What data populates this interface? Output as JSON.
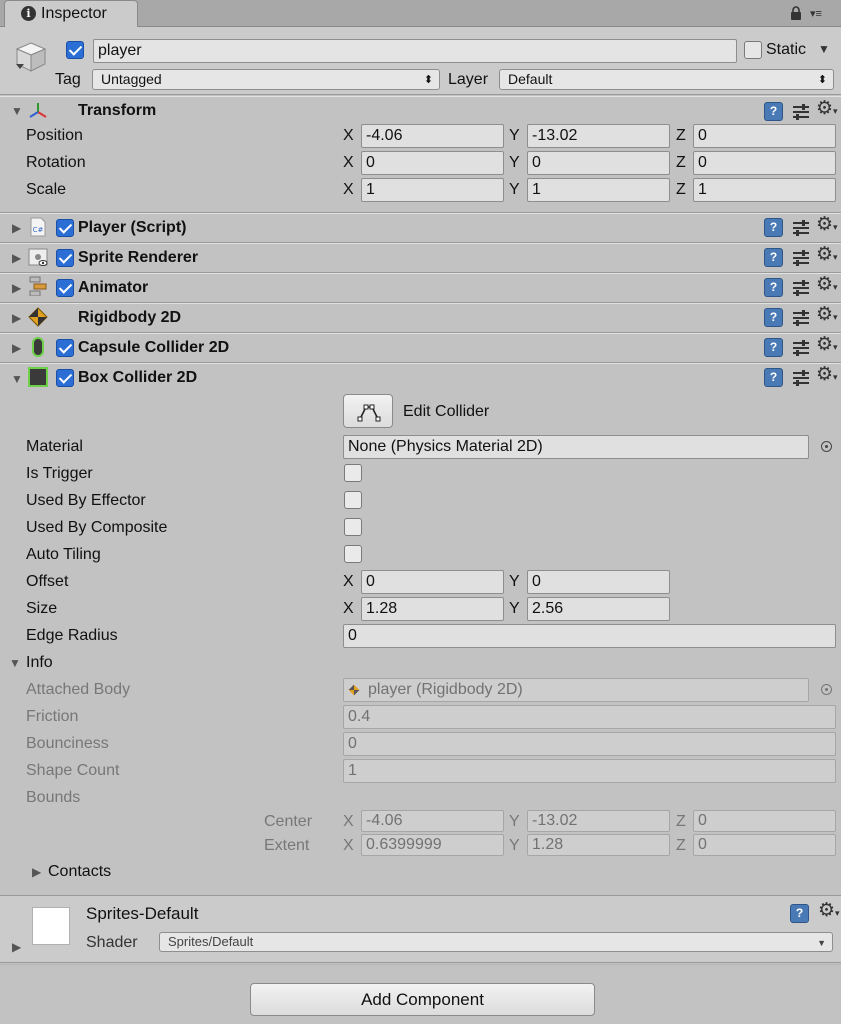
{
  "tab": {
    "title": "Inspector",
    "info_icon": "i"
  },
  "object": {
    "name": "player",
    "static_label": "Static",
    "tag_label": "Tag",
    "tag_value": "Untagged",
    "layer_label": "Layer",
    "layer_value": "Default"
  },
  "transform": {
    "title": "Transform",
    "rows": [
      {
        "label": "Position",
        "x": "-4.06",
        "y": "-13.02",
        "z": "0"
      },
      {
        "label": "Rotation",
        "x": "0",
        "y": "0",
        "z": "0"
      },
      {
        "label": "Scale",
        "x": "1",
        "y": "1",
        "z": "1"
      }
    ],
    "axis_x": "X",
    "axis_y": "Y",
    "axis_z": "Z"
  },
  "components": [
    {
      "title": "Player (Script)",
      "icon_text": "C#"
    },
    {
      "title": "Sprite Renderer"
    },
    {
      "title": "Animator"
    },
    {
      "title": "Rigidbody 2D"
    },
    {
      "title": "Capsule Collider 2D"
    }
  ],
  "box_collider": {
    "title": "Box Collider 2D",
    "edit_collider": "Edit Collider",
    "material_label": "Material",
    "material_value": "None (Physics Material 2D)",
    "is_trigger": "Is Trigger",
    "used_by_effector": "Used By Effector",
    "used_by_composite": "Used By Composite",
    "auto_tiling": "Auto Tiling",
    "offset_label": "Offset",
    "offset_x": "0",
    "offset_y": "0",
    "size_label": "Size",
    "size_x": "1.28",
    "size_y": "2.56",
    "edge_radius_label": "Edge Radius",
    "edge_radius": "0",
    "info": {
      "title": "Info",
      "attached_body_label": "Attached Body",
      "attached_body": "player (Rigidbody 2D)",
      "friction_label": "Friction",
      "friction": "0.4",
      "bounciness_label": "Bounciness",
      "bounciness": "0",
      "shape_count_label": "Shape Count",
      "shape_count": "1",
      "bounds_label": "Bounds",
      "center_label": "Center",
      "center_x": "-4.06",
      "center_y": "-13.02",
      "center_z": "0",
      "extent_label": "Extent",
      "extent_x": "0.6399999",
      "extent_y": "1.28",
      "extent_z": "0",
      "contacts": "Contacts"
    }
  },
  "material": {
    "name": "Sprites-Default",
    "shader_label": "Shader",
    "shader_value": "Sprites/Default"
  },
  "add_component": "Add Component",
  "help_glyph": "?"
}
